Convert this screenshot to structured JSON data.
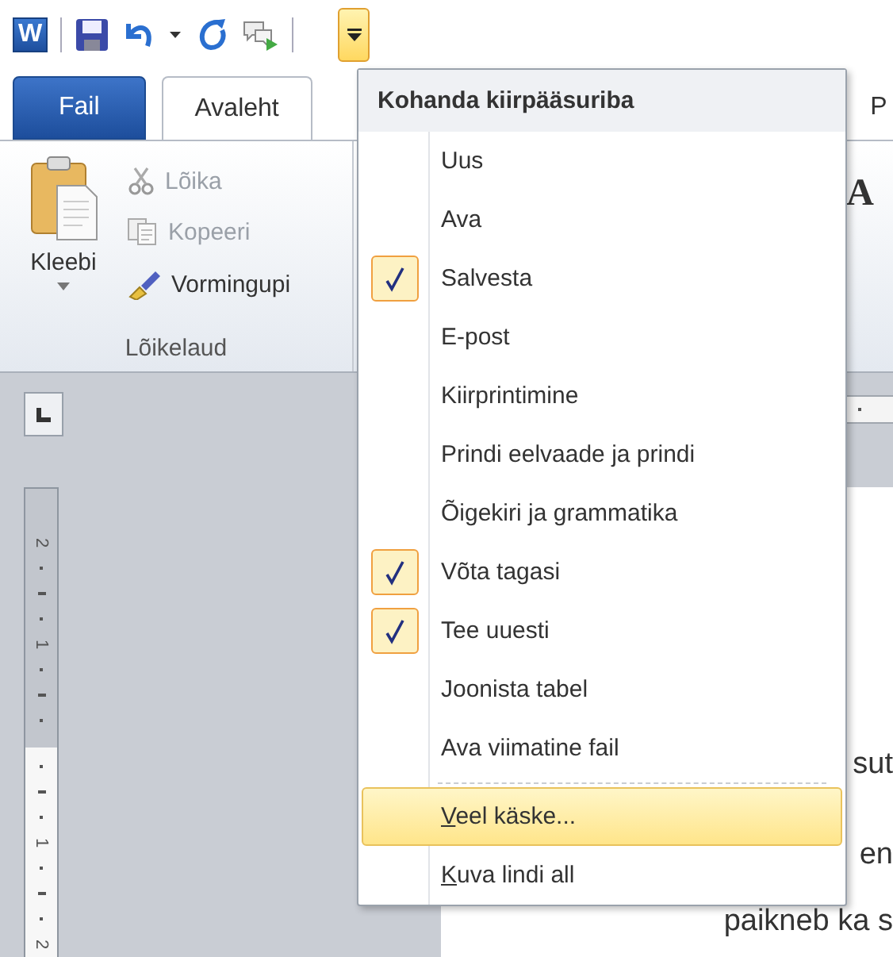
{
  "quick_access": {
    "app_logo": "W",
    "customize_open": true
  },
  "tabs": [
    {
      "label": "Fail",
      "kind": "file",
      "selected": false
    },
    {
      "label": "Avaleht",
      "kind": "tab",
      "selected": true
    },
    {
      "label": "P",
      "kind": "tab",
      "selected": false
    }
  ],
  "ribbon": {
    "clipboard": {
      "paste_label": "Kleebi",
      "group_label": "Lõikelaud",
      "commands": [
        {
          "label": "Lõika",
          "disabled": true
        },
        {
          "label": "Kopeeri",
          "disabled": true
        },
        {
          "label": "Vormingupi",
          "disabled": false
        }
      ]
    },
    "font_button": "A"
  },
  "vertical_ruler": {
    "labels": [
      "2",
      "1",
      "1",
      "2"
    ]
  },
  "document": {
    "lines": [
      "sut",
      "en",
      "paikneb ka s"
    ]
  },
  "menu": {
    "title": "Kohanda kiirpääsuriba",
    "items": [
      {
        "kind": "check",
        "label": "Uus",
        "checked": false,
        "highlighted": false
      },
      {
        "kind": "check",
        "label": "Ava",
        "checked": false,
        "highlighted": false
      },
      {
        "kind": "check",
        "label": "Salvesta",
        "checked": true,
        "highlighted": false
      },
      {
        "kind": "check",
        "label": "E-post",
        "checked": false,
        "highlighted": false
      },
      {
        "kind": "check",
        "label": "Kiirprintimine",
        "checked": false,
        "highlighted": false
      },
      {
        "kind": "check",
        "label": "Prindi eelvaade ja prindi",
        "checked": false,
        "highlighted": false
      },
      {
        "kind": "check",
        "label": "Õigekiri ja grammatika",
        "checked": false,
        "highlighted": false
      },
      {
        "kind": "check",
        "label": "Võta tagasi",
        "checked": true,
        "highlighted": false
      },
      {
        "kind": "check",
        "label": "Tee uuesti",
        "checked": true,
        "highlighted": false
      },
      {
        "kind": "check",
        "label": "Joonista tabel",
        "checked": false,
        "highlighted": false
      },
      {
        "kind": "check",
        "label": "Ava viimatine fail",
        "checked": false,
        "highlighted": false
      },
      {
        "kind": "separator"
      },
      {
        "kind": "command",
        "label": "Veel käske...",
        "highlighted": true
      },
      {
        "kind": "command",
        "label": "Kuva lindi all",
        "highlighted": false
      }
    ]
  }
}
